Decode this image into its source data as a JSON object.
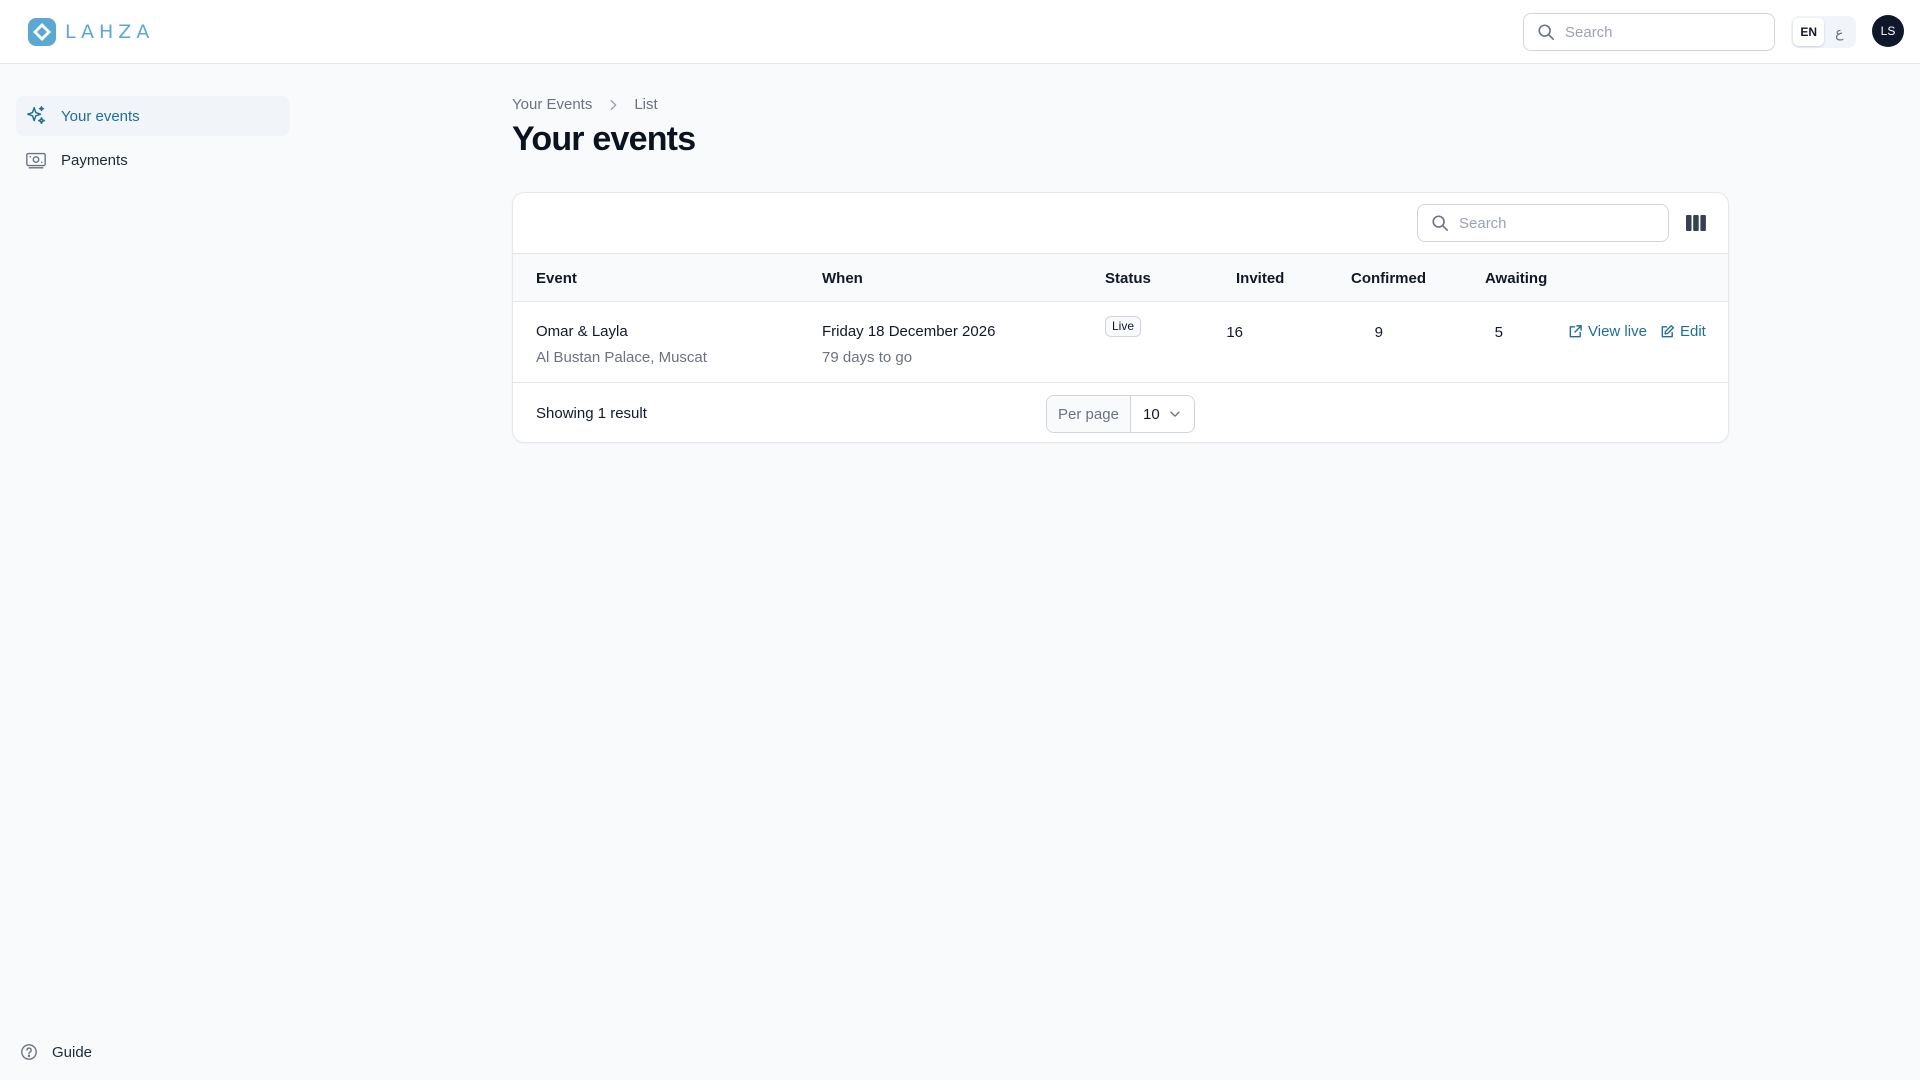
{
  "app": {
    "brand": "LAHZA",
    "accent_color": "#1d6f96",
    "logo_color": "#5ba8d2"
  },
  "header": {
    "search_placeholder": "Search",
    "language_active": "EN",
    "language_alt": "ع",
    "avatar_initials": "LS"
  },
  "sidebar": {
    "items": [
      {
        "label": "Your events",
        "icon": "sparkles-icon",
        "active": true
      },
      {
        "label": "Payments",
        "icon": "banknote-icon",
        "active": false
      }
    ],
    "guide_label": "Guide"
  },
  "breadcrumb": {
    "items": [
      "Your Events",
      "List"
    ]
  },
  "page": {
    "title": "Your events"
  },
  "table": {
    "search_placeholder": "Search",
    "columns": [
      "Event",
      "When",
      "Status",
      "Invited",
      "Confirmed",
      "Awaiting"
    ],
    "rows": [
      {
        "event_name": "Omar & Layla",
        "venue": "Al Bustan Palace, Muscat",
        "date": "Friday 18 December 2026",
        "countdown": "79 days to go",
        "status": "Live",
        "invited": "16",
        "confirmed": "9",
        "awaiting": "5",
        "actions": {
          "view_live": "View live",
          "edit": "Edit"
        }
      }
    ],
    "footer": {
      "result_text": "Showing 1 result",
      "per_page_label": "Per page",
      "per_page_value": "10"
    }
  }
}
